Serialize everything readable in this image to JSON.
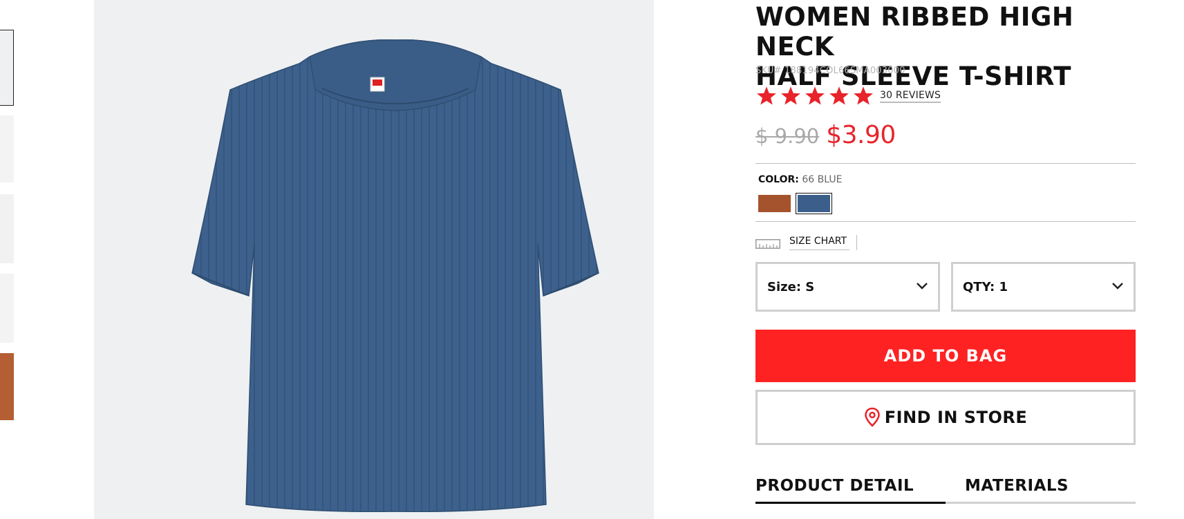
{
  "product": {
    "title_line1": "WOMEN RIBBED HIGH NECK",
    "title_line2": "HALF SLEEVE T-SHIRT",
    "sku": "SKU# 188194COL66SMA003000",
    "rating_stars": 5,
    "reviews_label": "30 REVIEWS",
    "original_price": "$ 9.90",
    "sale_price": "$3.90"
  },
  "color": {
    "label": "COLOR:",
    "value": "66 BLUE",
    "swatches": [
      {
        "name": "brown",
        "color": "#a5532c",
        "selected": false
      },
      {
        "name": "blue",
        "color": "#3b5f8a",
        "selected": true
      }
    ]
  },
  "size_chart": {
    "label": "SIZE CHART"
  },
  "selects": {
    "size_label": "Size: S",
    "qty_label": "QTY: 1"
  },
  "buttons": {
    "add_to_bag": "ADD TO BAG",
    "find_in_store": "FIND IN STORE"
  },
  "tabs": {
    "product_detail": "PRODUCT DETAIL",
    "materials": "MATERIALS",
    "active": "PRODUCT DETAIL"
  },
  "colors": {
    "accent_red": "#ff2222",
    "sale_red": "#e8232a",
    "shirt_blue": "#3b5f8a"
  }
}
